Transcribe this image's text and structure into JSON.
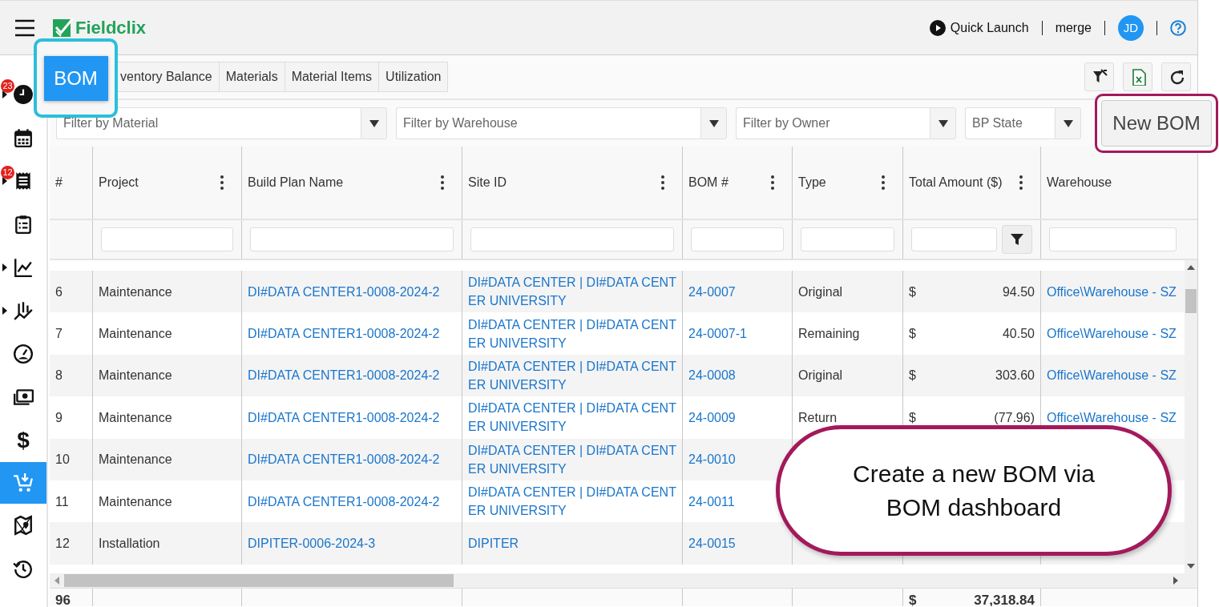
{
  "header": {
    "logo": "Fieldclix",
    "quick_launch": "Quick Launch",
    "account": "merge",
    "avatar": "JD"
  },
  "sidebar": {
    "items": [
      {
        "selected": false,
        "expandable": true,
        "badge": "23"
      },
      {
        "selected": false,
        "expandable": false
      },
      {
        "selected": false,
        "expandable": true,
        "badge": "12"
      },
      {
        "selected": false,
        "expandable": false
      },
      {
        "selected": false,
        "expandable": true
      },
      {
        "selected": false,
        "expandable": true
      },
      {
        "selected": false,
        "expandable": false
      },
      {
        "selected": false,
        "expandable": false
      },
      {
        "selected": false,
        "expandable": false,
        "label": "$"
      },
      {
        "selected": true,
        "expandable": false
      },
      {
        "selected": false,
        "expandable": false
      },
      {
        "selected": false,
        "expandable": false
      }
    ]
  },
  "tabs": [
    {
      "label": "BOM",
      "selected": true,
      "highlighted": true
    },
    {
      "label": "ventory Balance",
      "selected": false,
      "highlighted": false
    },
    {
      "label": "Materials",
      "selected": false,
      "highlighted": false
    },
    {
      "label": "Material Items",
      "selected": false,
      "highlighted": false
    },
    {
      "label": "Utilization",
      "selected": false,
      "highlighted": false
    }
  ],
  "filters": [
    {
      "placeholder": "Filter by Material"
    },
    {
      "placeholder": "Filter by Warehouse"
    },
    {
      "placeholder": "Filter by Owner"
    },
    {
      "placeholder": "BP State"
    }
  ],
  "new_button": {
    "label": "New BOM",
    "highlighted": true
  },
  "table": {
    "columns": [
      {
        "label": "#",
        "menu": false,
        "kind": "index"
      },
      {
        "label": "Project",
        "menu": true,
        "kind": "text"
      },
      {
        "label": "Build Plan Name",
        "menu": true,
        "kind": "link"
      },
      {
        "label": "Site ID",
        "menu": true,
        "kind": "link"
      },
      {
        "label": "BOM #",
        "menu": true,
        "kind": "link"
      },
      {
        "label": "Type",
        "menu": true,
        "kind": "text"
      },
      {
        "label": "Total Amount ($)",
        "menu": true,
        "kind": "amount"
      },
      {
        "label": "Warehouse",
        "menu": false,
        "kind": "link"
      }
    ],
    "rows": [
      {
        "cells": [
          "6",
          "Maintenance",
          "DI#DATA CENTER1-0008-2024-2",
          "DI#DATA CENTER | DI#DATA CENTER UNIVERSITY",
          "24-0007",
          "Original",
          {
            "currency": "$",
            "value": "94.50"
          },
          "Office\\Warehouse - SZ"
        ]
      },
      {
        "cells": [
          "7",
          "Maintenance",
          "DI#DATA CENTER1-0008-2024-2",
          "DI#DATA CENTER | DI#DATA CENTER UNIVERSITY",
          "24-0007-1",
          "Remaining",
          {
            "currency": "$",
            "value": "40.50"
          },
          "Office\\Warehouse - SZ"
        ]
      },
      {
        "cells": [
          "8",
          "Maintenance",
          "DI#DATA CENTER1-0008-2024-2",
          "DI#DATA CENTER | DI#DATA CENTER UNIVERSITY",
          "24-0008",
          "Original",
          {
            "currency": "$",
            "value": "303.60"
          },
          "Office\\Warehouse - SZ"
        ]
      },
      {
        "cells": [
          "9",
          "Maintenance",
          "DI#DATA CENTER1-0008-2024-2",
          "DI#DATA CENTER | DI#DATA CENTER UNIVERSITY",
          "24-0009",
          "Return",
          {
            "currency": "$",
            "value": "(77.96)"
          },
          "Office\\Warehouse - SZ"
        ]
      },
      {
        "cells": [
          "10",
          "Maintenance",
          "DI#DATA CENTER1-0008-2024-2",
          "DI#DATA CENTER | DI#DATA CENTER UNIVERSITY",
          "24-0010"
        ]
      },
      {
        "cells": [
          "11",
          "Maintenance",
          "DI#DATA CENTER1-0008-2024-2",
          "DI#DATA CENTER | DI#DATA CENTER UNIVERSITY",
          "24-0011"
        ]
      },
      {
        "cells": [
          "12",
          "Installation",
          "DIPITER-0006-2024-3",
          "DIPITER",
          "24-0015"
        ]
      }
    ],
    "footer": {
      "count": "96",
      "total": {
        "currency": "$",
        "value": "37,318.84"
      }
    }
  },
  "callout": {
    "text": "Create a new BOM via BOM dashboard"
  }
}
